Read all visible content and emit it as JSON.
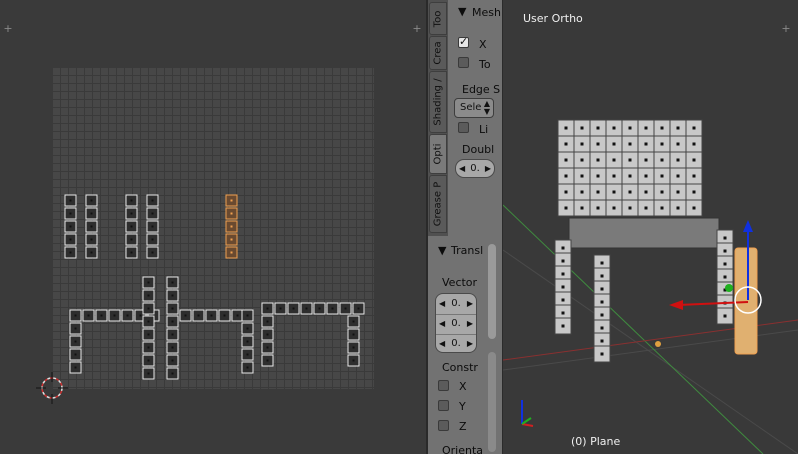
{
  "uv_editor": {
    "name": "uv-image-editor"
  },
  "tool_tabs": [
    {
      "label": "Too"
    },
    {
      "label": "Crea"
    },
    {
      "label": "Shading /"
    },
    {
      "label": "Opti"
    },
    {
      "label": "Grease P"
    }
  ],
  "tool_panel": {
    "title": "Mesh",
    "x_label": "X",
    "to_label": "To",
    "edge_label": "Edge S",
    "select_value": "Sele",
    "li_label": "Li",
    "double_label": "Doubl",
    "double_value": "0."
  },
  "redo_panel": {
    "title": "Transl",
    "vector_label": "Vector",
    "vector_values": [
      "0.",
      "0.",
      "0."
    ],
    "constraint_label": "Constr",
    "axes": [
      "X",
      "Y",
      "Z"
    ],
    "orientation_label": "Orienta"
  },
  "viewport": {
    "view_label": "User Ortho",
    "object_label": "(0) Plane"
  },
  "colors": {
    "selected": "#f0a050",
    "x_axis": "#d01010",
    "y_axis": "#20a020",
    "z_axis": "#1030c0"
  }
}
